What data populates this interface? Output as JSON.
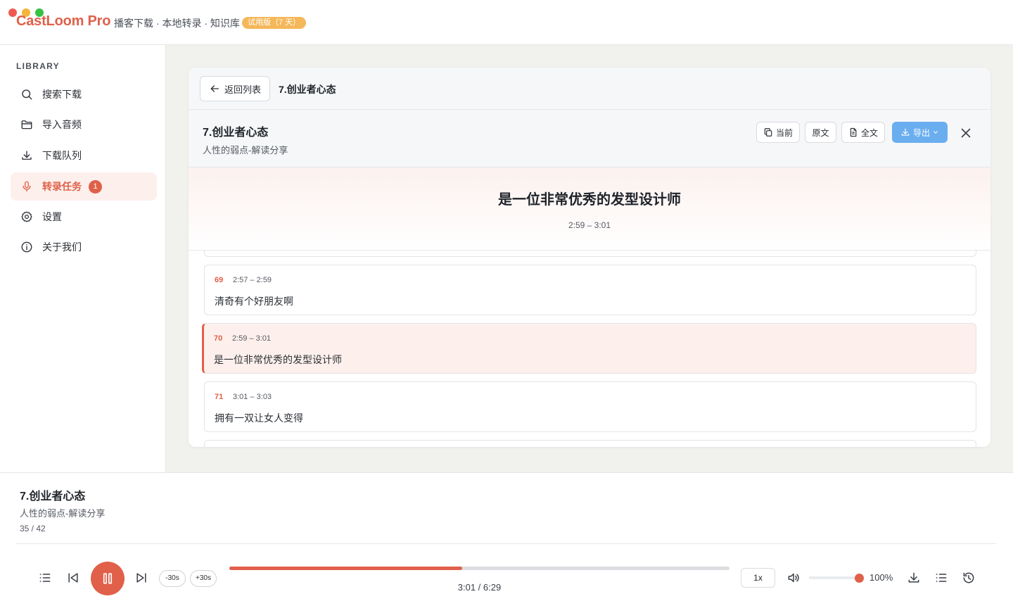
{
  "colors": {
    "accent": "#e0604a",
    "accent_soft": "#fdf0ec",
    "trial_badge": "#f4b75a",
    "export_button": "#6aaef0",
    "traffic_close": "#ee5a52",
    "traffic_min": "#f3b53a",
    "traffic_max": "#36c242"
  },
  "app": {
    "name": "CastLoom Pro",
    "tagline": "播客下载 · 本地转录 · 知识库",
    "trial_badge": "试用版（7 天）"
  },
  "sidebar": {
    "heading": "LIBRARY",
    "items": [
      {
        "label": "搜索下载",
        "icon": "search-icon"
      },
      {
        "label": "导入音频",
        "icon": "folder-icon"
      },
      {
        "label": "下载队列",
        "icon": "download-icon"
      },
      {
        "label": "转录任务",
        "icon": "microphone-icon",
        "badge": "1",
        "active": true
      },
      {
        "label": "设置",
        "icon": "gear-icon"
      },
      {
        "label": "关于我们",
        "icon": "info-icon"
      }
    ]
  },
  "detail": {
    "back_label": "返回列表",
    "breadcrumb_title": "7.创业者心态",
    "title": "7.创业者心态",
    "subtitle": "人性的弱点-解读分享",
    "toolbar": {
      "current_label": "当前",
      "original_label": "原文",
      "full_text_label": "全文",
      "export_label": "导出"
    },
    "current_segment": {
      "text": "是一位非常优秀的发型设计师",
      "time": "2:59 – 3:01"
    },
    "segments": [
      {
        "num": "69",
        "time": "2:57 – 2:59",
        "text": "清奇有个好朋友啊",
        "active": false
      },
      {
        "num": "70",
        "time": "2:59 – 3:01",
        "text": "是一位非常优秀的发型设计师",
        "active": true
      },
      {
        "num": "71",
        "time": "3:01 – 3:03",
        "text": "拥有一双让女人变得",
        "active": false
      }
    ]
  },
  "player": {
    "title": "7.创业者心态",
    "subtitle": "人性的弱点-解读分享",
    "position": "35 / 42",
    "back_label": "-30s",
    "forward_label": "+30s",
    "time": "3:01 / 6:29",
    "progress": 0.465,
    "speed": "1x",
    "volume_label": "100%",
    "volume": 1.0
  }
}
